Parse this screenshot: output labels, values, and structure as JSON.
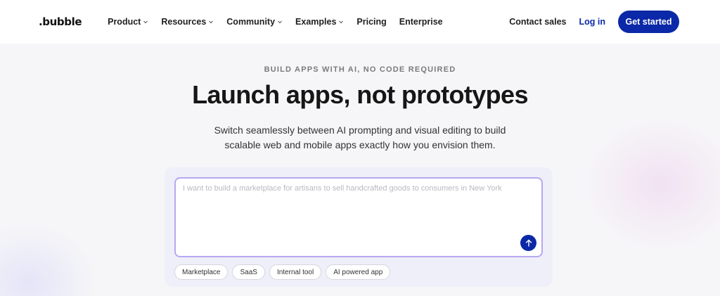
{
  "nav": {
    "logo": ".bubble",
    "menu": [
      {
        "label": "Product",
        "has_dropdown": true
      },
      {
        "label": "Resources",
        "has_dropdown": true
      },
      {
        "label": "Community",
        "has_dropdown": true
      },
      {
        "label": "Examples",
        "has_dropdown": true
      },
      {
        "label": "Pricing",
        "has_dropdown": false
      },
      {
        "label": "Enterprise",
        "has_dropdown": false
      }
    ],
    "contact_sales": "Contact sales",
    "login": "Log in",
    "get_started": "Get started"
  },
  "hero": {
    "eyebrow": "BUILD APPS WITH AI, NO CODE REQUIRED",
    "headline": "Launch apps, not prototypes",
    "subhead": "Switch seamlessly between AI prompting and visual editing to build scalable web and mobile apps exactly how you envision them."
  },
  "prompt": {
    "value": "",
    "placeholder": "I want to build a marketplace for artisans to sell handcrafted goods to consumers in New York",
    "send_icon": "arrow-up-icon",
    "chips": [
      "Marketplace",
      "SaaS",
      "Internal tool",
      "AI powered app"
    ]
  },
  "colors": {
    "brand": "#0b28a8",
    "prompt_border": "#b7a8f0",
    "background": "#f6f6f8"
  }
}
